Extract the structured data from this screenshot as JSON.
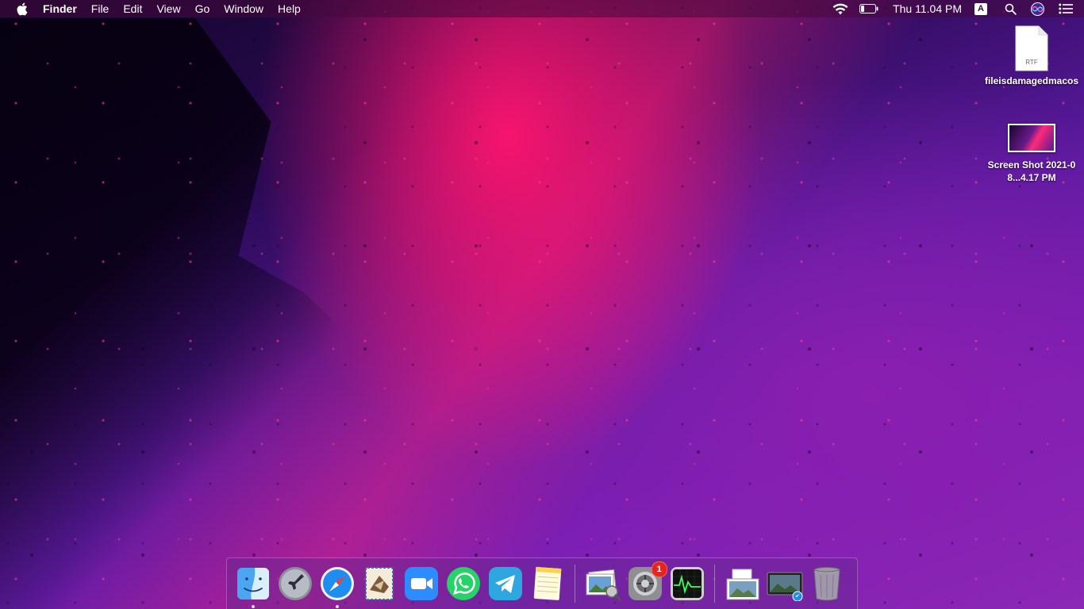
{
  "menubar": {
    "app_name": "Finder",
    "menus": [
      "File",
      "Edit",
      "View",
      "Go",
      "Window",
      "Help"
    ],
    "clock": "Thu 11.04 PM",
    "input_source": "A"
  },
  "desktop_items": [
    {
      "label": "fileisdamagedmacos",
      "type_label": "RTF",
      "icon": "rtf-document-icon"
    },
    {
      "label": "Screen Shot 2021-08...4.17 PM",
      "icon": "screenshot-thumbnail-icon"
    }
  ],
  "dock": {
    "apps": [
      {
        "name": "Finder",
        "icon": "finder-icon",
        "running": true
      },
      {
        "name": "Launchpad",
        "icon": "launchpad-icon",
        "running": false
      },
      {
        "name": "Safari",
        "icon": "safari-icon",
        "running": true
      },
      {
        "name": "Mail",
        "icon": "mail-icon",
        "running": false
      },
      {
        "name": "Zoom",
        "icon": "zoom-icon",
        "running": false
      },
      {
        "name": "WhatsApp",
        "icon": "whatsapp-icon",
        "running": false
      },
      {
        "name": "Telegram",
        "icon": "telegram-icon",
        "running": false
      },
      {
        "name": "Notes",
        "icon": "notes-icon",
        "running": false
      },
      {
        "name": "Preview",
        "icon": "preview-icon",
        "running": false
      },
      {
        "name": "System Preferences",
        "icon": "system-preferences-icon",
        "running": false,
        "badge": "1"
      },
      {
        "name": "Activity Monitor",
        "icon": "activity-monitor-icon",
        "running": false
      },
      {
        "name": "Documents",
        "icon": "documents-stack-icon",
        "running": false
      },
      {
        "name": "Downloads",
        "icon": "downloads-stack-icon",
        "running": false
      },
      {
        "name": "Trash",
        "icon": "trash-icon",
        "running": false
      }
    ]
  },
  "colors": {
    "wallpaper_pink": "#ff1a6e",
    "wallpaper_purple": "#7a1fb5",
    "badge_red": "#e8231f"
  }
}
